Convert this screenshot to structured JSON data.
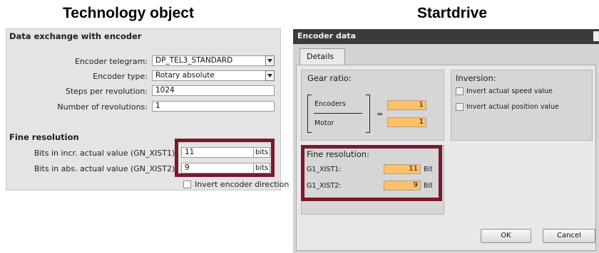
{
  "left_heading": "Technology object",
  "right_heading": "Startdrive",
  "technology_object": {
    "section_title": "Data exchange with encoder",
    "encoder_telegram": {
      "label": "Encoder telegram:",
      "value": "DP_TEL3_STANDARD"
    },
    "encoder_type": {
      "label": "Encoder type:",
      "value": "Rotary absolute"
    },
    "steps_per_revolution": {
      "label": "Steps per revolution:",
      "value": "1024"
    },
    "number_of_revolutions": {
      "label": "Number of revolutions:",
      "value": "1"
    },
    "fine_resolution_title": "Fine resolution",
    "bits_incr": {
      "label": "Bits in incr. actual value (GN_XIST1):",
      "value": "11",
      "unit": "bits"
    },
    "bits_abs": {
      "label": "Bits in abs. actual value (GN_XIST2):",
      "value": "9",
      "unit": "bits"
    },
    "invert_encoder_direction": {
      "label": "Invert encoder direction",
      "checked": false
    }
  },
  "startdrive": {
    "dialog_title": "Encoder data",
    "tab_details": "Details",
    "gear_ratio": {
      "title": "Gear ratio:",
      "encoders_label": "Encoders",
      "motor_label": "Motor",
      "equals": "=",
      "encoders_value": "1",
      "motor_value": "1"
    },
    "inversion": {
      "title": "Inversion:",
      "invert_speed": {
        "label": "Invert actual speed value",
        "checked": false
      },
      "invert_position": {
        "label": "Invert actual position value",
        "checked": false
      }
    },
    "fine_resolution": {
      "title": "Fine resolution:",
      "g1_xist1": {
        "label": "G1_XIST1:",
        "value": "11",
        "unit": "Bit"
      },
      "g1_xist2": {
        "label": "G1_XIST2:",
        "value": "9",
        "unit": "Bit"
      }
    },
    "ok_label": "OK",
    "cancel_label": "Cancel"
  },
  "colors": {
    "highlight_box": "#7a1a2a",
    "field_orange": "#ffc06a",
    "title_bar": "#3b3b3b"
  }
}
